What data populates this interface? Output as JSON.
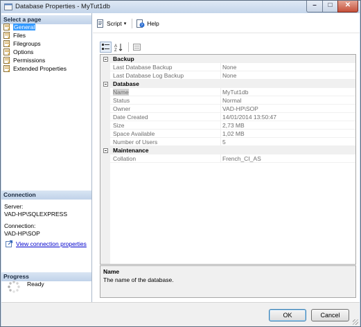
{
  "window": {
    "title": "Database Properties - MyTut1db"
  },
  "left": {
    "select_page_header": "Select a page",
    "pages": [
      {
        "label": "General",
        "icon": "page-icon",
        "selected": true
      },
      {
        "label": "Files",
        "icon": "page-icon"
      },
      {
        "label": "Filegroups",
        "icon": "page-icon"
      },
      {
        "label": "Options",
        "icon": "page-icon"
      },
      {
        "label": "Permissions",
        "icon": "page-icon"
      },
      {
        "label": "Extended Properties",
        "icon": "page-icon"
      }
    ],
    "connection": {
      "header": "Connection",
      "server_label": "Server:",
      "server_value": "VAD-HP\\SQLEXPRESS",
      "connection_label": "Connection:",
      "connection_value": "VAD-HP\\SOP",
      "link": "View connection properties"
    },
    "progress": {
      "header": "Progress",
      "status": "Ready"
    }
  },
  "toolbar": {
    "script_label": "Script",
    "help_label": "Help"
  },
  "grid": {
    "backup": {
      "title": "Backup",
      "rows": [
        {
          "name": "Last Database Backup",
          "value": "None"
        },
        {
          "name": "Last Database Log Backup",
          "value": "None"
        }
      ]
    },
    "database": {
      "title": "Database",
      "rows": [
        {
          "name": "Name",
          "value": "MyTut1db"
        },
        {
          "name": "Status",
          "value": "Normal"
        },
        {
          "name": "Owner",
          "value": "VAD-HP\\SOP"
        },
        {
          "name": "Date Created",
          "value": "14/01/2014 13:50:47"
        },
        {
          "name": "Size",
          "value": "2,73 MB"
        },
        {
          "name": "Space Available",
          "value": "1,02 MB"
        },
        {
          "name": "Number of Users",
          "value": "5"
        }
      ]
    },
    "maintenance": {
      "title": "Maintenance",
      "rows": [
        {
          "name": "Collation",
          "value": "French_CI_AS"
        }
      ]
    }
  },
  "description": {
    "title": "Name",
    "text": "The name of the database."
  },
  "buttons": {
    "ok": "OK",
    "cancel": "Cancel"
  },
  "colors": {
    "selection": "#3399ff",
    "link": "#0000cc",
    "section_header": "#c0d2e9"
  }
}
